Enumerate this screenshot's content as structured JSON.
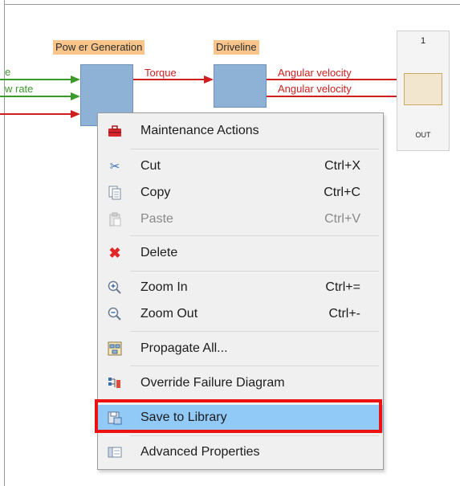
{
  "diagram": {
    "blocks": [
      {
        "label": "Pow er Generation"
      },
      {
        "label": "Driveline"
      }
    ],
    "signals_left": [
      "e",
      "w rate"
    ],
    "signals_right": [
      "Torque",
      "Angular velocity",
      "Angular velocity"
    ],
    "outport": {
      "number": "1",
      "name": "OUT"
    },
    "colors": {
      "green": "#3c9a2b",
      "red": "#d11f1f",
      "block": "#8eb1d6",
      "label_bg": "#f9c58a"
    }
  },
  "context_menu": {
    "items": [
      {
        "label": "Maintenance Actions",
        "shortcut": "",
        "icon": "toolbox-icon"
      },
      {
        "label": "Cut",
        "shortcut": "Ctrl+X",
        "icon": "scissors-icon"
      },
      {
        "label": "Copy",
        "shortcut": "Ctrl+C",
        "icon": "copy-icon"
      },
      {
        "label": "Paste",
        "shortcut": "Ctrl+V",
        "icon": "paste-icon",
        "disabled": true
      },
      {
        "label": "Delete",
        "shortcut": "",
        "icon": "delete-x-icon"
      },
      {
        "label": "Zoom In",
        "shortcut": "Ctrl+=",
        "icon": "zoom-in-icon"
      },
      {
        "label": "Zoom Out",
        "shortcut": "Ctrl+-",
        "icon": "zoom-out-icon"
      },
      {
        "label": "Propagate All...",
        "shortcut": "",
        "icon": "propagate-icon"
      },
      {
        "label": "Override Failure Diagram",
        "shortcut": "",
        "icon": "override-diagram-icon"
      },
      {
        "label": "Save to Library",
        "shortcut": "",
        "icon": "save-library-icon",
        "highlighted": true
      },
      {
        "label": "Advanced Properties",
        "shortcut": "",
        "icon": "properties-icon"
      }
    ],
    "highlight_color": "#91c9f7",
    "annotation_color": "#ee1111"
  }
}
